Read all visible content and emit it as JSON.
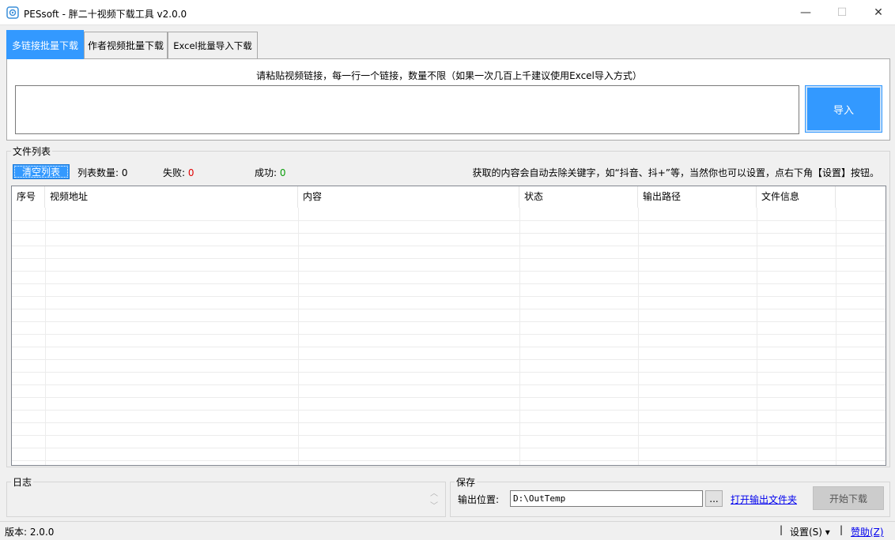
{
  "window": {
    "title": "PESsoft - 胖二十视频下载工具 v2.0.0",
    "min_glyph": "—",
    "max_glyph": "☐",
    "close_glyph": "✕"
  },
  "tabs": [
    {
      "label": "多链接批量下载",
      "active": true
    },
    {
      "label": "作者视频批量下载",
      "active": false
    },
    {
      "label": "Excel批量导入下载",
      "active": false
    }
  ],
  "panel": {
    "hint": "请粘贴视频链接，每一行一个链接，数量不限（如果一次几百上千建议使用Excel导入方式）",
    "links_value": "",
    "import_label": "导入"
  },
  "file_list": {
    "legend": "文件列表",
    "clear_label": "清空列表",
    "count_label": "列表数量:",
    "count_value": "0",
    "fail_label": "失败:",
    "fail_value": "0",
    "success_label": "成功:",
    "success_value": "0",
    "info": "获取的内容会自动去除关键字，如“抖音、抖+”等，当然你也可以设置，点右下角【设置】按钮。",
    "columns": [
      "序号",
      "视频地址",
      "内容",
      "状态",
      "输出路径",
      "文件信息"
    ]
  },
  "log": {
    "legend": "日志",
    "up_glyph": "︿",
    "down_glyph": "﹀"
  },
  "save": {
    "legend": "保存",
    "output_label": "输出位置:",
    "output_value": "D:\\OutTemp",
    "browse_label": "...",
    "open_folder_label": "打开输出文件夹",
    "start_label": "开始下载"
  },
  "status_bar": {
    "version": "版本: 2.0.0",
    "separator": "|",
    "settings_label": "设置(S) ▾",
    "sponsor_label": "赞助(Z)"
  },
  "colors": {
    "accent": "#3399ff",
    "fail": "#e00000",
    "success": "#0a9e0a",
    "link": "#0000ee"
  }
}
